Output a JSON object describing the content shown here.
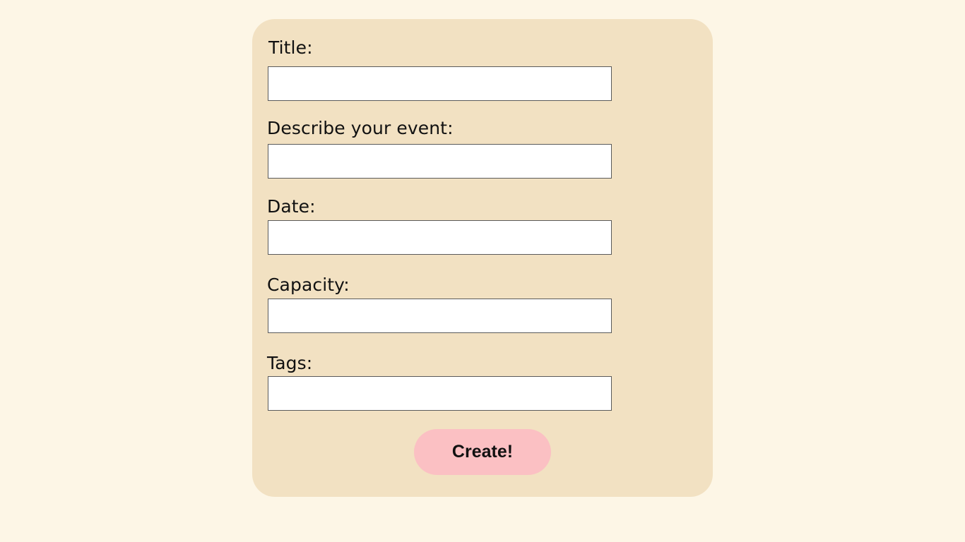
{
  "form": {
    "fields": [
      {
        "label": "Title:",
        "value": "",
        "placeholder": ""
      },
      {
        "label": "Describe your event:",
        "value": "",
        "placeholder": ""
      },
      {
        "label": "Date:",
        "value": "",
        "placeholder": ""
      },
      {
        "label": "Capacity:",
        "value": "",
        "placeholder": ""
      },
      {
        "label": "Tags:",
        "value": "",
        "placeholder": ""
      }
    ],
    "submit_label": "Create!"
  },
  "colors": {
    "page_background": "#fdf6e6",
    "card_background": "#f2e1c2",
    "button_background": "#fbc0c3",
    "input_border": "#5a5a5a"
  }
}
